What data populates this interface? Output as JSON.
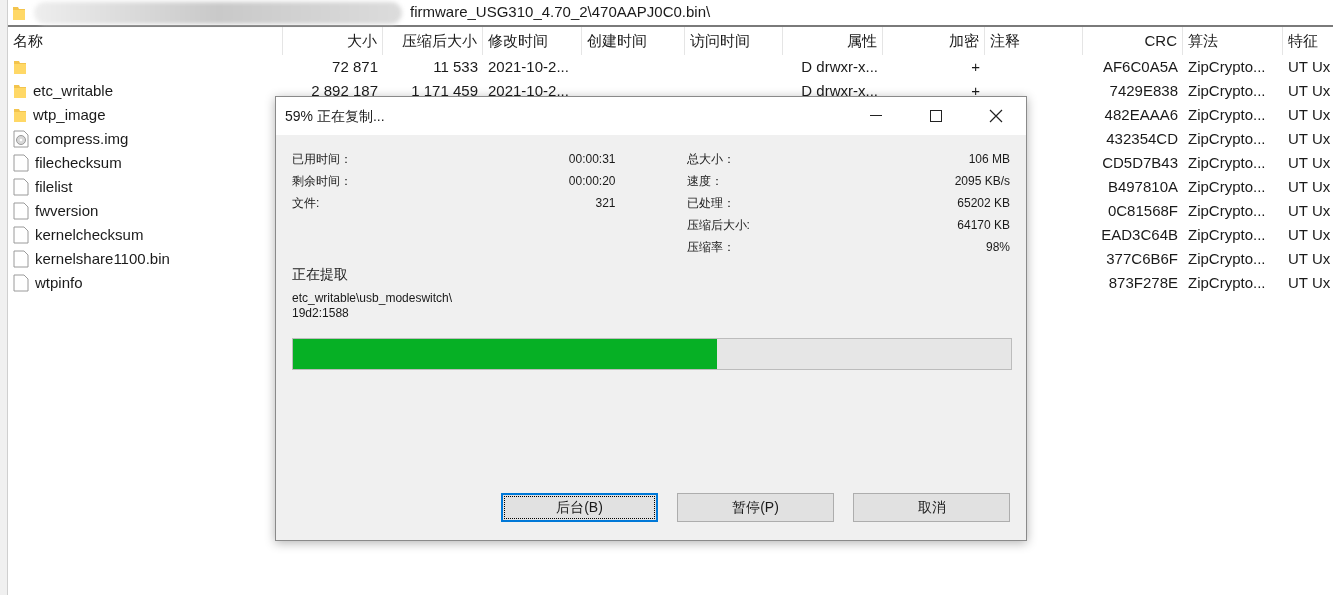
{
  "path": "firmware_USG310_4.70_2\\470AAPJ0C0.bin\\",
  "table": {
    "columns": [
      "名称",
      "大小",
      "压缩后大小",
      "修改时间",
      "创建时间",
      "访问时间",
      "属性",
      "加密",
      "注释",
      "CRC",
      "算法",
      "特征"
    ],
    "rows": [
      {
        "kind": "folder",
        "size": "72 871",
        "packed": "11 533",
        "modified": "2021-10-2...",
        "attributes": "D drwxr-x...",
        "encrypted": "+",
        "crc": "AF6C0A5A",
        "method": "ZipCrypto...",
        "characteristics": "UT Ux"
      },
      {
        "kind": "folder",
        "name": "etc_writable",
        "size": "2 892 187",
        "packed": "1 171 459",
        "modified": "2021-10-2...",
        "attributes": "D drwxr-x...",
        "encrypted": "+",
        "crc": "7429E838",
        "method": "ZipCrypto...",
        "characteristics": "UT Ux"
      },
      {
        "kind": "folder",
        "name": "wtp_image",
        "crc": "482EAAA6",
        "method": "ZipCrypto...",
        "characteristics": "UT Ux"
      },
      {
        "kind": "disc",
        "name": "compress.img",
        "crc": "432354CD",
        "method": "ZipCrypto...",
        "characteristics": "UT Ux"
      },
      {
        "kind": "file",
        "name": "filechecksum",
        "crc": "CD5D7B43",
        "method": "ZipCrypto...",
        "characteristics": "UT Ux"
      },
      {
        "kind": "file",
        "name": "filelist",
        "crc": "B497810A",
        "method": "ZipCrypto...",
        "characteristics": "UT Ux"
      },
      {
        "kind": "file",
        "name": "fwversion",
        "crc": "0C81568F",
        "method": "ZipCrypto...",
        "characteristics": "UT Ux"
      },
      {
        "kind": "file",
        "name": "kernelchecksum",
        "crc": "EAD3C64B",
        "method": "ZipCrypto...",
        "characteristics": "UT Ux"
      },
      {
        "kind": "file",
        "name": "kernelshare1100.bin",
        "crc": "377C6B6F",
        "method": "ZipCrypto...",
        "characteristics": "UT Ux"
      },
      {
        "kind": "file",
        "name": "wtpinfo",
        "crc": "873F278E",
        "method": "ZipCrypto...",
        "characteristics": "UT Ux"
      }
    ]
  },
  "dialog": {
    "title": "59% 正在复制...",
    "left_stats": [
      {
        "label": "已用时间：",
        "value": "00:00:31"
      },
      {
        "label": "剩余时间：",
        "value": "00:00:20"
      },
      {
        "label": "文件:",
        "value": "321"
      }
    ],
    "right_stats": [
      {
        "label": "总大小：",
        "value": "106 MB"
      },
      {
        "label": "速度：",
        "value": "2095 KB/s"
      },
      {
        "label": "已处理：",
        "value": "65202 KB"
      },
      {
        "label": "压缩后大小:",
        "value": "64170 KB"
      },
      {
        "label": "压缩率：",
        "value": "98%"
      }
    ],
    "section": "正在提取",
    "current_file": [
      "etc_writable\\usb_modeswitch\\",
      "19d2:1588"
    ],
    "progress": {
      "level": 0.59
    },
    "buttons": [
      {
        "label": "后台(B)",
        "focused": true
      },
      {
        "label": "暂停(P)",
        "focused": false
      },
      {
        "label": "取消",
        "focused": false
      }
    ]
  }
}
